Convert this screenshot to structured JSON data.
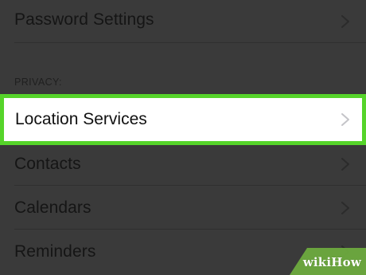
{
  "settings": {
    "rows_top": [
      {
        "label": "Password Settings"
      }
    ],
    "section_header": "PRIVACY:",
    "highlighted_row": {
      "label": "Location Services"
    },
    "rows_bottom": [
      {
        "label": "Contacts"
      },
      {
        "label": "Calendars"
      },
      {
        "label": "Reminders"
      }
    ],
    "chevron_icon": "chevron-right-icon"
  },
  "colors": {
    "dim_background": "#3a3a3a",
    "highlight_border": "#56d42a",
    "highlight_background": "#ffffff",
    "watermark_green": "#6fae3f"
  },
  "watermark": {
    "text_wiki": "wiki",
    "text_how": "How"
  }
}
